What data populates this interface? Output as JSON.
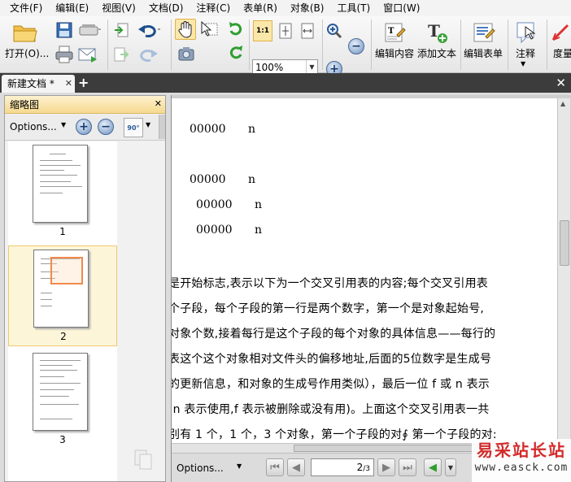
{
  "menu": [
    "文件(F)",
    "编辑(E)",
    "视图(V)",
    "文档(D)",
    "注释(C)",
    "表单(R)",
    "对象(B)",
    "工具(T)",
    "窗口(W)"
  ],
  "toolbar": {
    "open_label": "打开(O)...",
    "zoom_value": "100%",
    "fit_label": "1:1",
    "edit_content": "编辑内容",
    "add_text": "添加文本",
    "edit_form": "编辑表单",
    "annotate": "注释",
    "measure": "度量"
  },
  "tab": {
    "title": "新建文档 *"
  },
  "panel": {
    "title": "缩略图",
    "options": "Options...",
    "rotate_label": "90°",
    "thumbs": [
      "1",
      "2",
      "3"
    ],
    "selected": "2"
  },
  "document": {
    "xref": [
      "00000",
      "n",
      "00000",
      "n",
      "00000",
      "n",
      "00000",
      "n"
    ],
    "text_lines": [
      "是开始标志,表示以下为一个交叉引用表的内容;每个交叉引用表",
      "个子段，每个子段的第一行是两个数字，第一个是对象起始号,",
      "对象个数,接着每行是这个子段的每个对象的具体信息——每行的",
      "表这个这个对象相对文件头的偏移地址,后面的5位数字是生成号",
      "的更新信息，和对象的生成号作用类似），最后一位 f 或 n 表示",
      "(n 表示使用,f 表示被删除或没有用)。上面这个交叉引用表一共",
      "别有 1 个，1 个，3 个对象，第一个子段的对∮  第一个子段的对:"
    ]
  },
  "status": {
    "options": "Options...",
    "page": "2",
    "total": "/3"
  },
  "watermark": {
    "line1": "易采站长站",
    "line2": "www.easck.com"
  }
}
